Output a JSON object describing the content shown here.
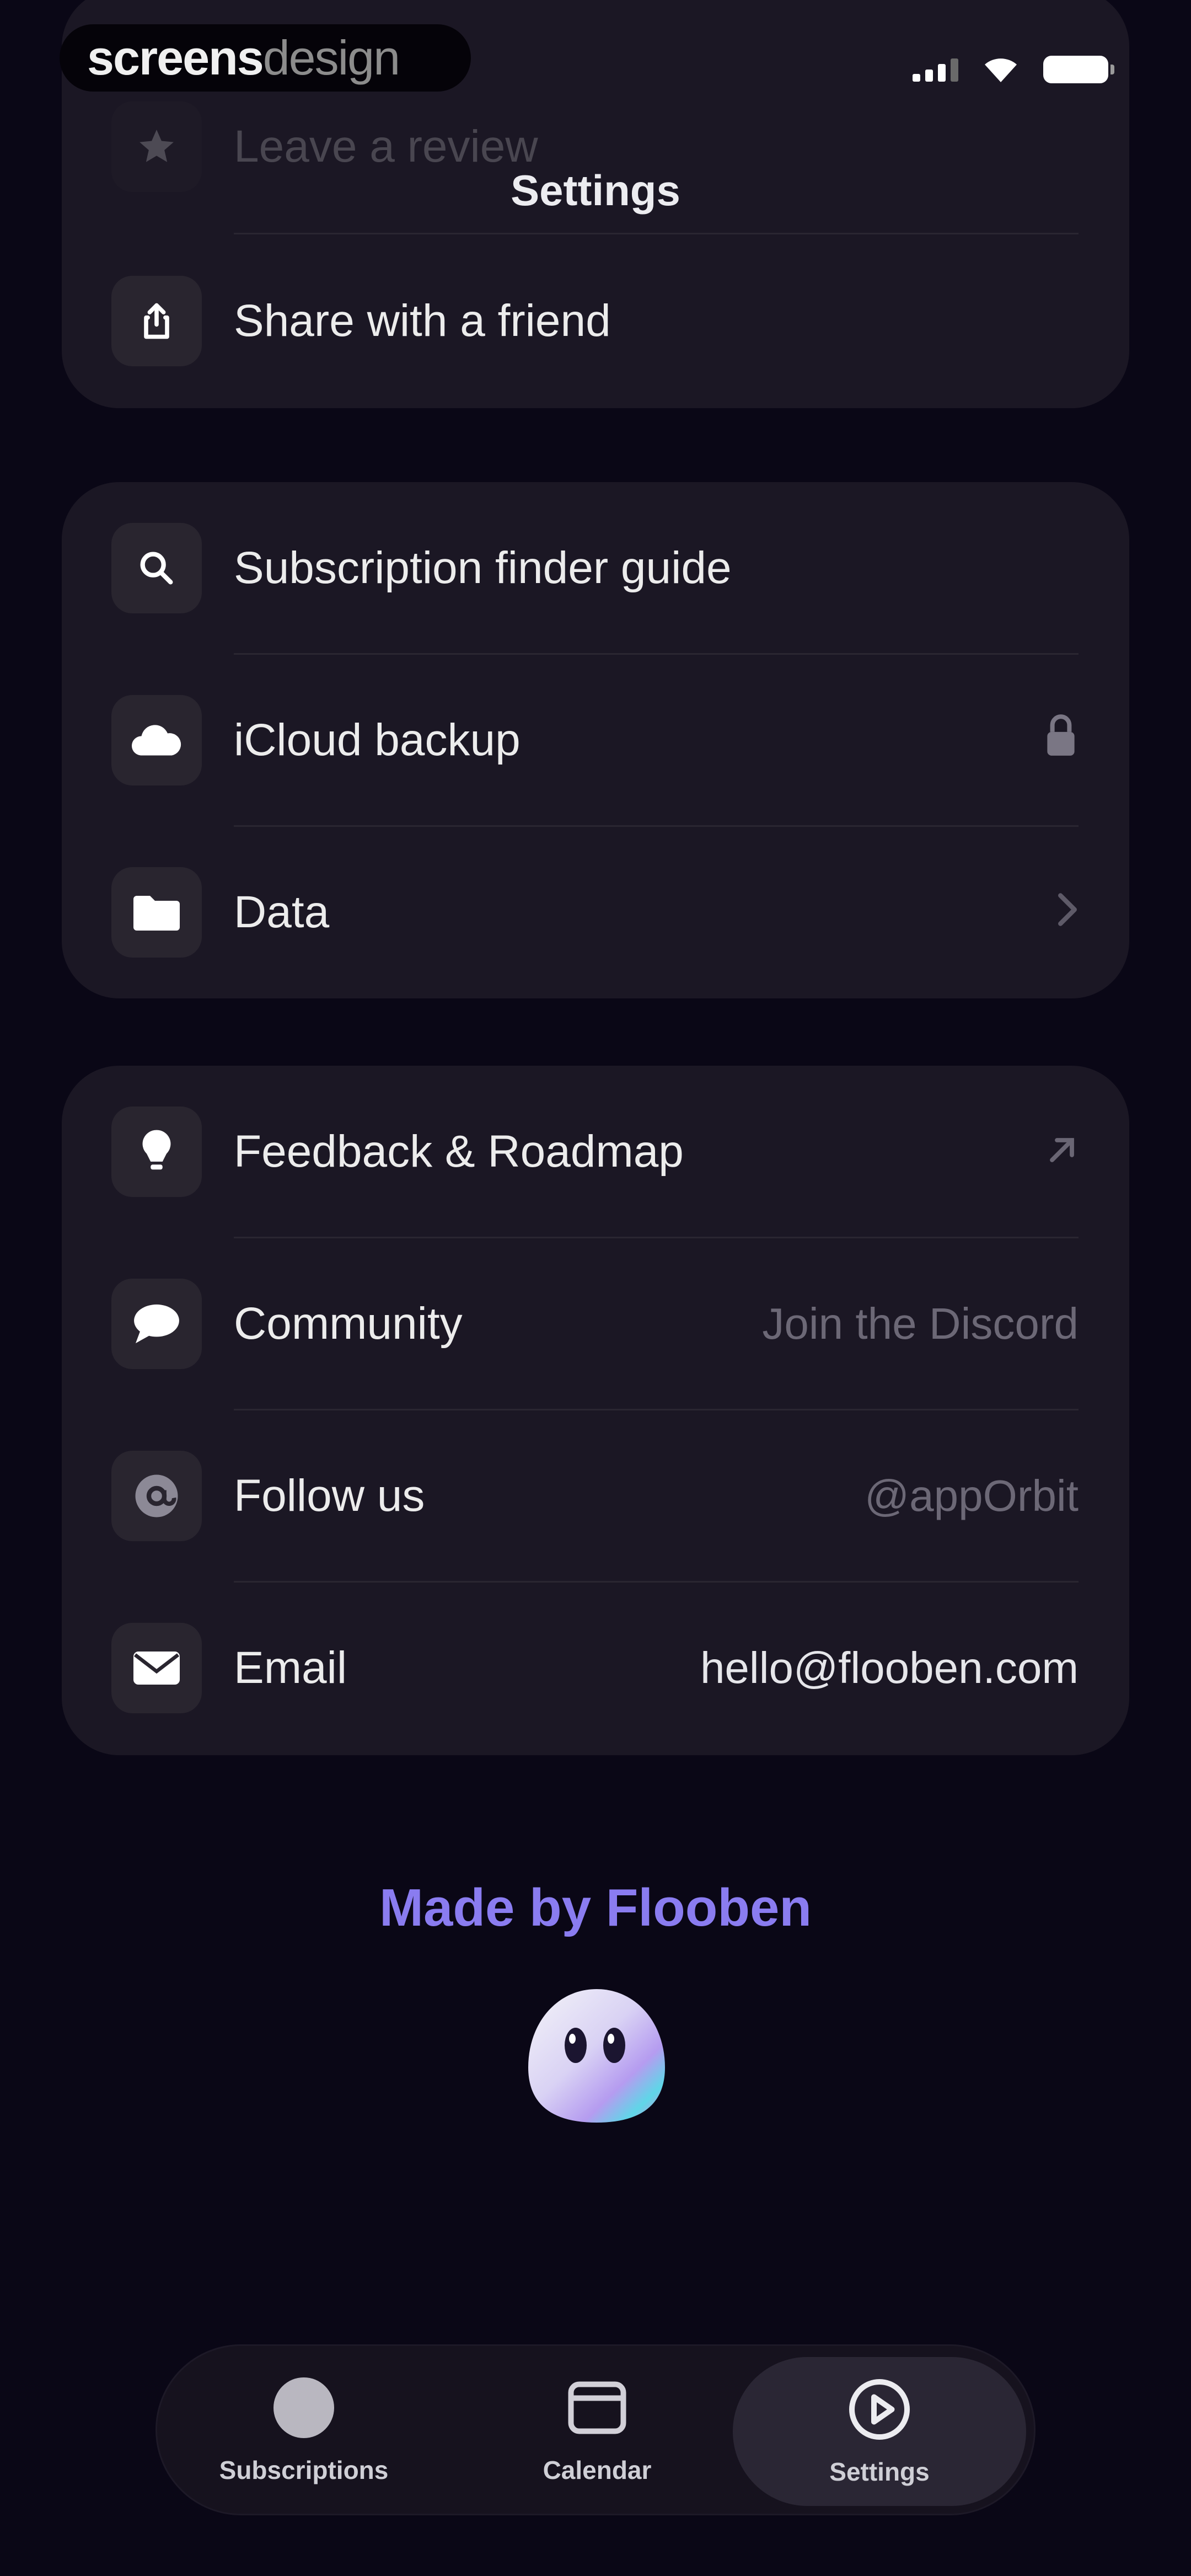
{
  "watermark": {
    "part1": "screens",
    "part2": "design"
  },
  "nav": {
    "title": "Settings"
  },
  "group1": {
    "items": [
      {
        "label": "Leave a review",
        "icon": "star-icon"
      },
      {
        "label": "Share with a friend",
        "icon": "share-icon"
      }
    ]
  },
  "group2": {
    "items": [
      {
        "label": "Subscription finder guide",
        "icon": "search-icon"
      },
      {
        "label": "iCloud backup",
        "icon": "cloud-icon",
        "accessory": "lock-icon"
      },
      {
        "label": "Data",
        "icon": "folder-icon",
        "accessory": "chevron-right-icon"
      }
    ]
  },
  "group3": {
    "items": [
      {
        "label": "Feedback & Roadmap",
        "icon": "lightbulb-icon",
        "accessory": "arrow-up-right-icon"
      },
      {
        "label": "Community",
        "value": "Join the Discord",
        "icon": "chat-bubble-icon"
      },
      {
        "label": "Follow us",
        "value": "@appOrbit",
        "icon": "at-sign-icon"
      },
      {
        "label": "Email",
        "value": "hello@flooben.com",
        "icon": "envelope-icon"
      }
    ]
  },
  "footer": {
    "made_by": "Made by Flooben",
    "mascot": "ghost-mascot"
  },
  "tabs": [
    {
      "label": "Subscriptions",
      "icon": "circle-icon",
      "active": false
    },
    {
      "label": "Calendar",
      "icon": "calendar-icon",
      "active": false
    },
    {
      "label": "Settings",
      "icon": "play-circle-icon",
      "active": true
    }
  ],
  "colors": {
    "background": "#0a0716",
    "card": "#1b1724",
    "accent": "#8a7cf0"
  }
}
